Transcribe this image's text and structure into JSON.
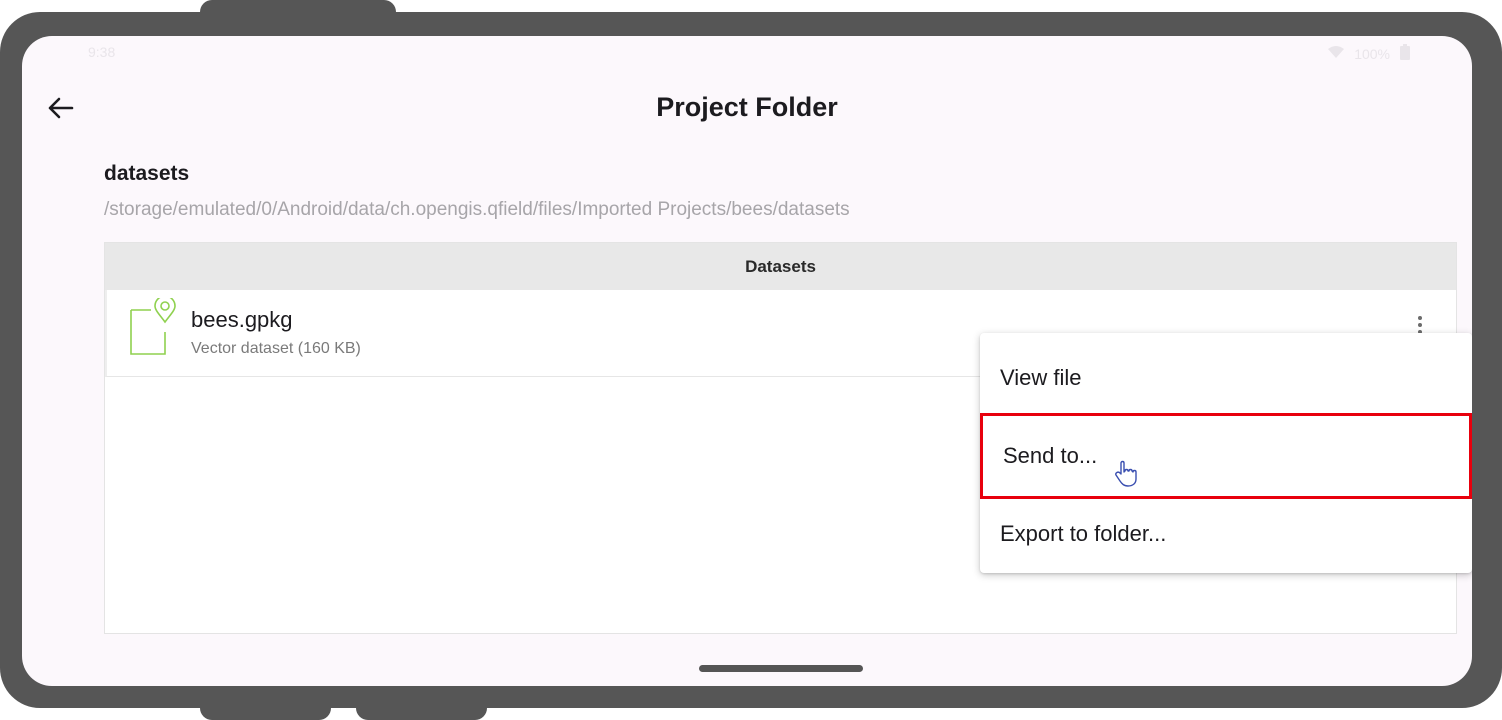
{
  "status_bar": {
    "time": "9:38",
    "battery": "100%"
  },
  "header": {
    "back_icon": "arrow-left-icon",
    "title": "Project Folder"
  },
  "folder": {
    "name": "datasets",
    "path": "/storage/emulated/0/Android/data/ch.opengis.qfield/files/Imported Projects/bees/datasets"
  },
  "datasets_panel": {
    "header": "Datasets",
    "items": [
      {
        "icon": "vector-dataset-icon",
        "name": "bees.gpkg",
        "description": "Vector dataset (160 KB)",
        "menu_icon": "more-vertical-icon"
      }
    ]
  },
  "context_menu": {
    "items": [
      {
        "label": "View file"
      },
      {
        "label": "Send to..."
      },
      {
        "label": "Export to folder..."
      }
    ],
    "highlight_color": "#e8000d"
  },
  "colors": {
    "frame": "#565656",
    "screen_bg": "#fcf8fc",
    "icon_accent": "#8fd14f"
  }
}
